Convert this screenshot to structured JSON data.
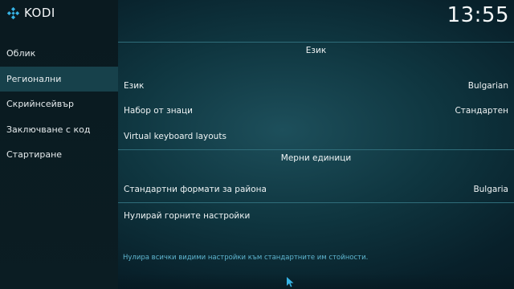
{
  "app": {
    "name": "KODI",
    "clock": "13:55"
  },
  "sidebar": {
    "items": [
      {
        "label": "Облик"
      },
      {
        "label": "Регионални",
        "active": true
      },
      {
        "label": "Скрийнсейвър"
      },
      {
        "label": "Заключване с код"
      },
      {
        "label": "Стартиране"
      }
    ]
  },
  "groups": {
    "language": {
      "header": "Език",
      "rows": [
        {
          "label": "Език",
          "value": "Bulgarian"
        },
        {
          "label": "Набор от знаци",
          "value": "Стандартен"
        },
        {
          "label": "Virtual keyboard layouts",
          "value": ""
        }
      ]
    },
    "units": {
      "header": "Мерни единици",
      "rows": [
        {
          "label": "Стандартни формати за района",
          "value": "Bulgaria"
        },
        {
          "label": "Нулирай горните настройки",
          "value": ""
        }
      ]
    }
  },
  "help_text": "Нулира всички видими настройки към стандартните им стойности.",
  "colors": {
    "accent": "#17414b",
    "separator": "#2f6d7a",
    "help": "#5fb6d0"
  }
}
